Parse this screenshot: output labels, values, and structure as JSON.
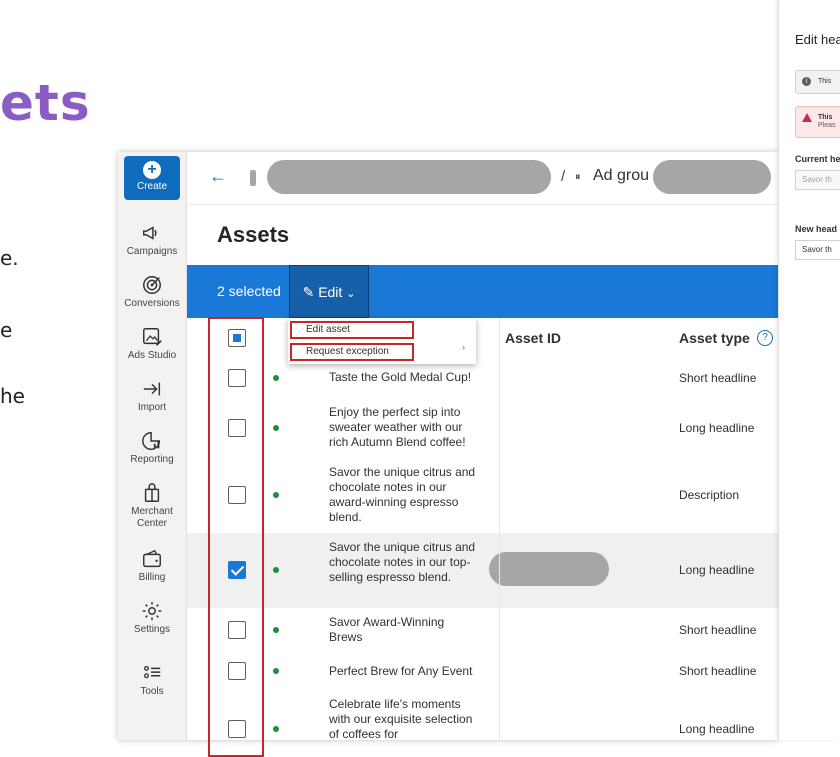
{
  "slide": {
    "title_fragment": "ets",
    "text_fragments": [
      "e.",
      "e",
      "he"
    ]
  },
  "rail": {
    "create_label": "Create",
    "items": [
      {
        "label": "Campaigns",
        "icon": "megaphone-icon"
      },
      {
        "label": "Conversions",
        "icon": "target-icon"
      },
      {
        "label": "Ads Studio",
        "icon": "image-edit-icon"
      },
      {
        "label": "Import",
        "icon": "import-arrow-icon"
      },
      {
        "label": "Reporting",
        "icon": "pie-chart-icon"
      },
      {
        "label": "Merchant Center",
        "icon": "shopping-bag-icon"
      },
      {
        "label": "Billing",
        "icon": "wallet-icon"
      },
      {
        "label": "Settings",
        "icon": "gear-icon"
      },
      {
        "label": "Tools",
        "icon": "tools-list-icon"
      }
    ]
  },
  "topbar": {
    "separator": "/",
    "adgroup_fragment": "Ad grou"
  },
  "page": {
    "title": "Assets"
  },
  "action_bar": {
    "selected_label": "2 selected",
    "edit_label": "Edit"
  },
  "dropdown": {
    "items": [
      "Edit asset",
      "Request exception"
    ]
  },
  "table": {
    "headers": {
      "asset_id": "Asset ID",
      "asset_type": "Asset type"
    },
    "rows": [
      {
        "asset": "Taste the Gold Medal Cup!",
        "type": "Short headline",
        "selected": false
      },
      {
        "asset": "Enjoy the perfect sip into sweater weather with our rich Autumn Blend coffee!",
        "type": "Long headline",
        "selected": false
      },
      {
        "asset": "Savor the unique citrus and chocolate notes in our award-winning espresso blend.",
        "type": "Description",
        "selected": false
      },
      {
        "asset": "Savor the unique citrus and chocolate notes in our top-selling espresso blend.",
        "type": "Long headline",
        "selected": true
      },
      {
        "asset": "Savor Award-Winning Brews",
        "type": "Short headline",
        "selected": false
      },
      {
        "asset": "Perfect Brew for Any Event",
        "type": "Short headline",
        "selected": false
      },
      {
        "asset": "Celebrate life's moments with our exquisite selection of coffees for",
        "type": "Long headline",
        "selected": false
      }
    ]
  },
  "panel": {
    "title": "Edit hea",
    "info_text": "This",
    "warn_text": "This",
    "warn_text2": "Pleas",
    "current_label": "Current he",
    "current_value": "Savor th",
    "new_label": "New head",
    "new_value": "Savor th"
  },
  "colors": {
    "accent": "#1a78d6",
    "highlight_border": "#c62828",
    "status_green": "#1e8e3e",
    "slide_title": "#8a5cc4"
  }
}
